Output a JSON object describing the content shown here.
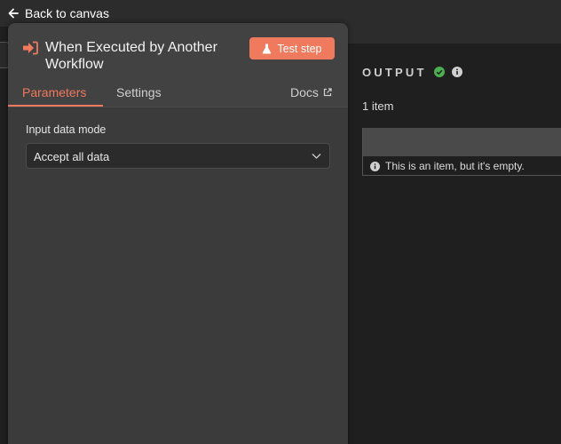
{
  "topbar": {
    "back_label": "Back to canvas"
  },
  "node": {
    "title": "When Executed by Another Workflow",
    "test_button_label": "Test step"
  },
  "tabs": [
    {
      "label": "Parameters",
      "active": true
    },
    {
      "label": "Settings",
      "active": false
    },
    {
      "label": "Docs",
      "active": false
    }
  ],
  "parameters": {
    "input_data_mode": {
      "label": "Input data mode",
      "value": "Accept all data"
    }
  },
  "output": {
    "title": "OUTPUT",
    "item_count": "1 item",
    "empty_message": "This is an item, but it's empty."
  },
  "colors": {
    "accent": "#ef7a5e",
    "success": "#4caf50"
  }
}
